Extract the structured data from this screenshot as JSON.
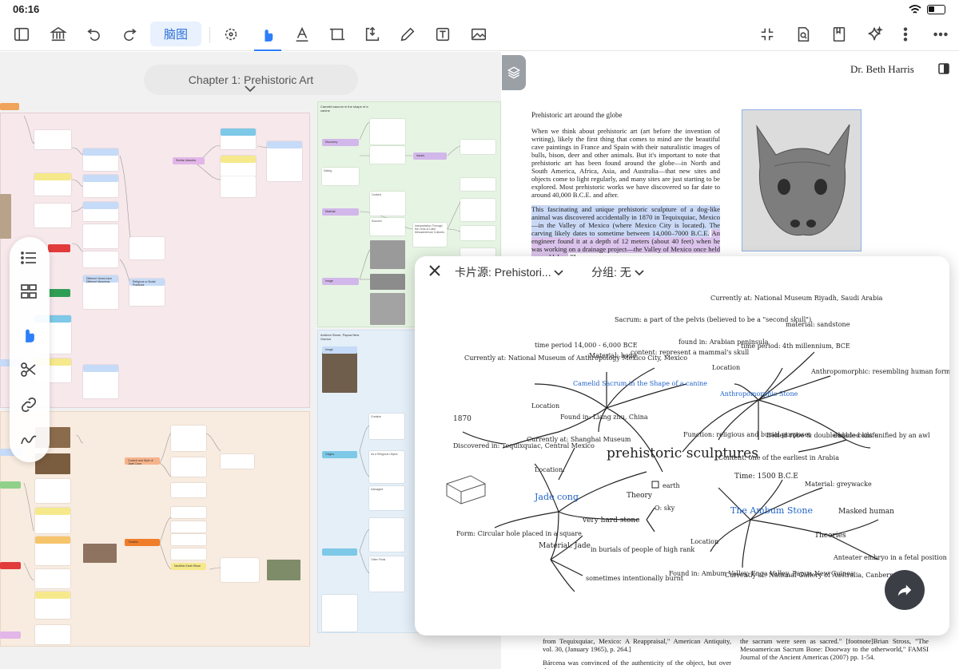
{
  "status": {
    "time": "06:16"
  },
  "toolbar": {
    "mindmap_label": "脑图",
    "left_icons": [
      "sidebar-icon",
      "library-icon",
      "undo-icon",
      "redo-icon"
    ],
    "tool_icons": [
      "lasso-icon",
      "pointer-hand-icon",
      "text-color-icon",
      "frame-icon",
      "resize-icon",
      "pen-icon",
      "textbox-icon",
      "image-icon"
    ],
    "right_icons": [
      "collapse-icon",
      "page-search-icon",
      "bookmark-icon",
      "ai-sparkle-icon",
      "more-vertical-icon",
      "more-horizontal-icon"
    ],
    "accent": "#2d7ff9"
  },
  "canvas": {
    "chapter_title": "Chapter 1: Prehistoric Art",
    "panels": {
      "camelid_title": "Camelid sacrum in the shape of a canine",
      "ambum_title": "Ambum Stone, Papua New Guinea"
    },
    "nodes": {
      "n1": "Sacrum, a part of the pelvis (believed to be a \"second skull\")",
      "n2": "Similar Artworks",
      "n3": "Discovery",
      "n4": "Dating",
      "n5": "Material",
      "n6": "Context",
      "n7": "Sources",
      "n8": "Image",
      "n9": "Issues",
      "n10": "Interpretation Through the Lens of Later Mesoamerican Cultures",
      "n11": "Image",
      "n12": "Creation",
      "n13": "Origins",
      "n14": "As a Religious Object",
      "n15": "Damaged",
      "n16": "Other Finds",
      "n17": "Timeline",
      "n18": "Context and Style of Jade Cong",
      "n19": "Neolithic Earth Ritual",
      "n20": "Different Views have Different Meanings",
      "n21": "Religious or Burial Practices"
    }
  },
  "doc": {
    "author": "Dr. Beth Harris",
    "heading": "Prehistoric art around the globe",
    "para1": "When we think about prehistoric art (art before the invention of writing), likely the first thing that comes to mind are the beautiful cave paintings in France and Spain with their naturalistic images of bulls, bison, deer and other animals. But it's important to note that prehistoric art has been found around the globe—in North and South America, Africa, Asia, and Australia—that new sites and objects come to light regularly, and many sites are just starting to be explored. Most prehistoric works we have discovered so far date to around 40,000 B.C.E. and after.",
    "para2_blue": "This fascinating and unique prehistoric sculpture of a dog-like animal was discovered accidentally in 1870 in Tequixquiac, Mexico—in the Valley of Mexico (where Mexico City is located). The carving likely dates to sometime between 14,000–7000 B.C.E.",
    "para2_purple": "An engineer found it at a depth of 12 meters (about 40 feet) when he was working on a drainage project—the Valley of Mexico once held several lakes.",
    "para2_tail": "The",
    "foot_left": "from Tequixquiac, Mexico: A Reappraisal,\" American Antiquity, vol. 30, (January 1965), p. 264.]",
    "foot_left2": "Bárcena was convinced of the authenticity of the object, but over the",
    "foot_right": "the sacrum were seen as sacred.\" [footnote]Brian Stross, \"The Mesoamerican Sacrum Bone: Doorway to the otherworld,\" FAMSI Journal of the Ancient Americas (2007) pp. 1-54."
  },
  "popup": {
    "source_label": "卡片源: Prehistori...",
    "group_label": "分组: 无",
    "sketch": {
      "center": "prehistoric sculptures",
      "camelid": "Camelid Sacrum in the Shape of a canine",
      "ambum": "Anthropomorphic Stone",
      "ambum_stone": "The Ambum Stone",
      "jade": "Jade cong",
      "t_currently_mexico": "Currently at: National Museum of Anthropology Mexico City, Mexico",
      "t_time_camelid": "time period 14,000 - 6,000 BCE",
      "t_material_bone": "Material: bone",
      "t_sacrum": "Sacrum: a part of the pelvis (believed to be a \"second skull\")",
      "t_content": "content: represent a mammal's skull",
      "t_found_arabia": "found in: Arabian peninsula",
      "t_riyadh": "Currently at: National Museum Riyadh, Saudi Arabia",
      "t_time_4th": "time period: 4th millennium, BCE",
      "t_material_sandstone": "material: sandstone",
      "t_anthropomorphic": "Anthropomorphic: resembling human form but not in itself human",
      "t_belted": "Belted robe & double-bladed knife",
      "t_double_coils": "double coils unified by an awl",
      "t_function": "Function: religious and burial purposes",
      "t_content_arabia": "Content: one of the earliest in Arabia",
      "t_location1": "Location",
      "t_location2": "Location",
      "t_location3": "Location:",
      "t_location4": "Location",
      "t_1870": "1870",
      "t_discovered": "Discovered in: Tequixquiac, Central Mexico",
      "t_found_liang": "Found in: Liang zhu, China",
      "t_currently_shanghai": "Currently at: Shanghai Museum",
      "t_theory": "Theory",
      "t_earth": "earth",
      "t_sky": "O: sky",
      "t_time_1500": "Time: 1500 B.C.E",
      "t_material_greywacke": "Material: greywacke",
      "t_masked": "Masked human",
      "t_theories": "Theories",
      "t_anteater": "Anteater embryo in a fetal position",
      "t_form": "Form: Circular hole placed in a square",
      "t_very_hard": "very hard stone",
      "t_material_jade": "Material: Jade",
      "t_burials": "in burials of people of high rank",
      "t_burnt": "sometimes intentionally burnt",
      "t_found_ambum": "Found in: Ambum Valley, Enga Valley, Papua New Guinea",
      "t_currently_australia": "Currently at: National Gallery of Australia, Canberra"
    }
  }
}
